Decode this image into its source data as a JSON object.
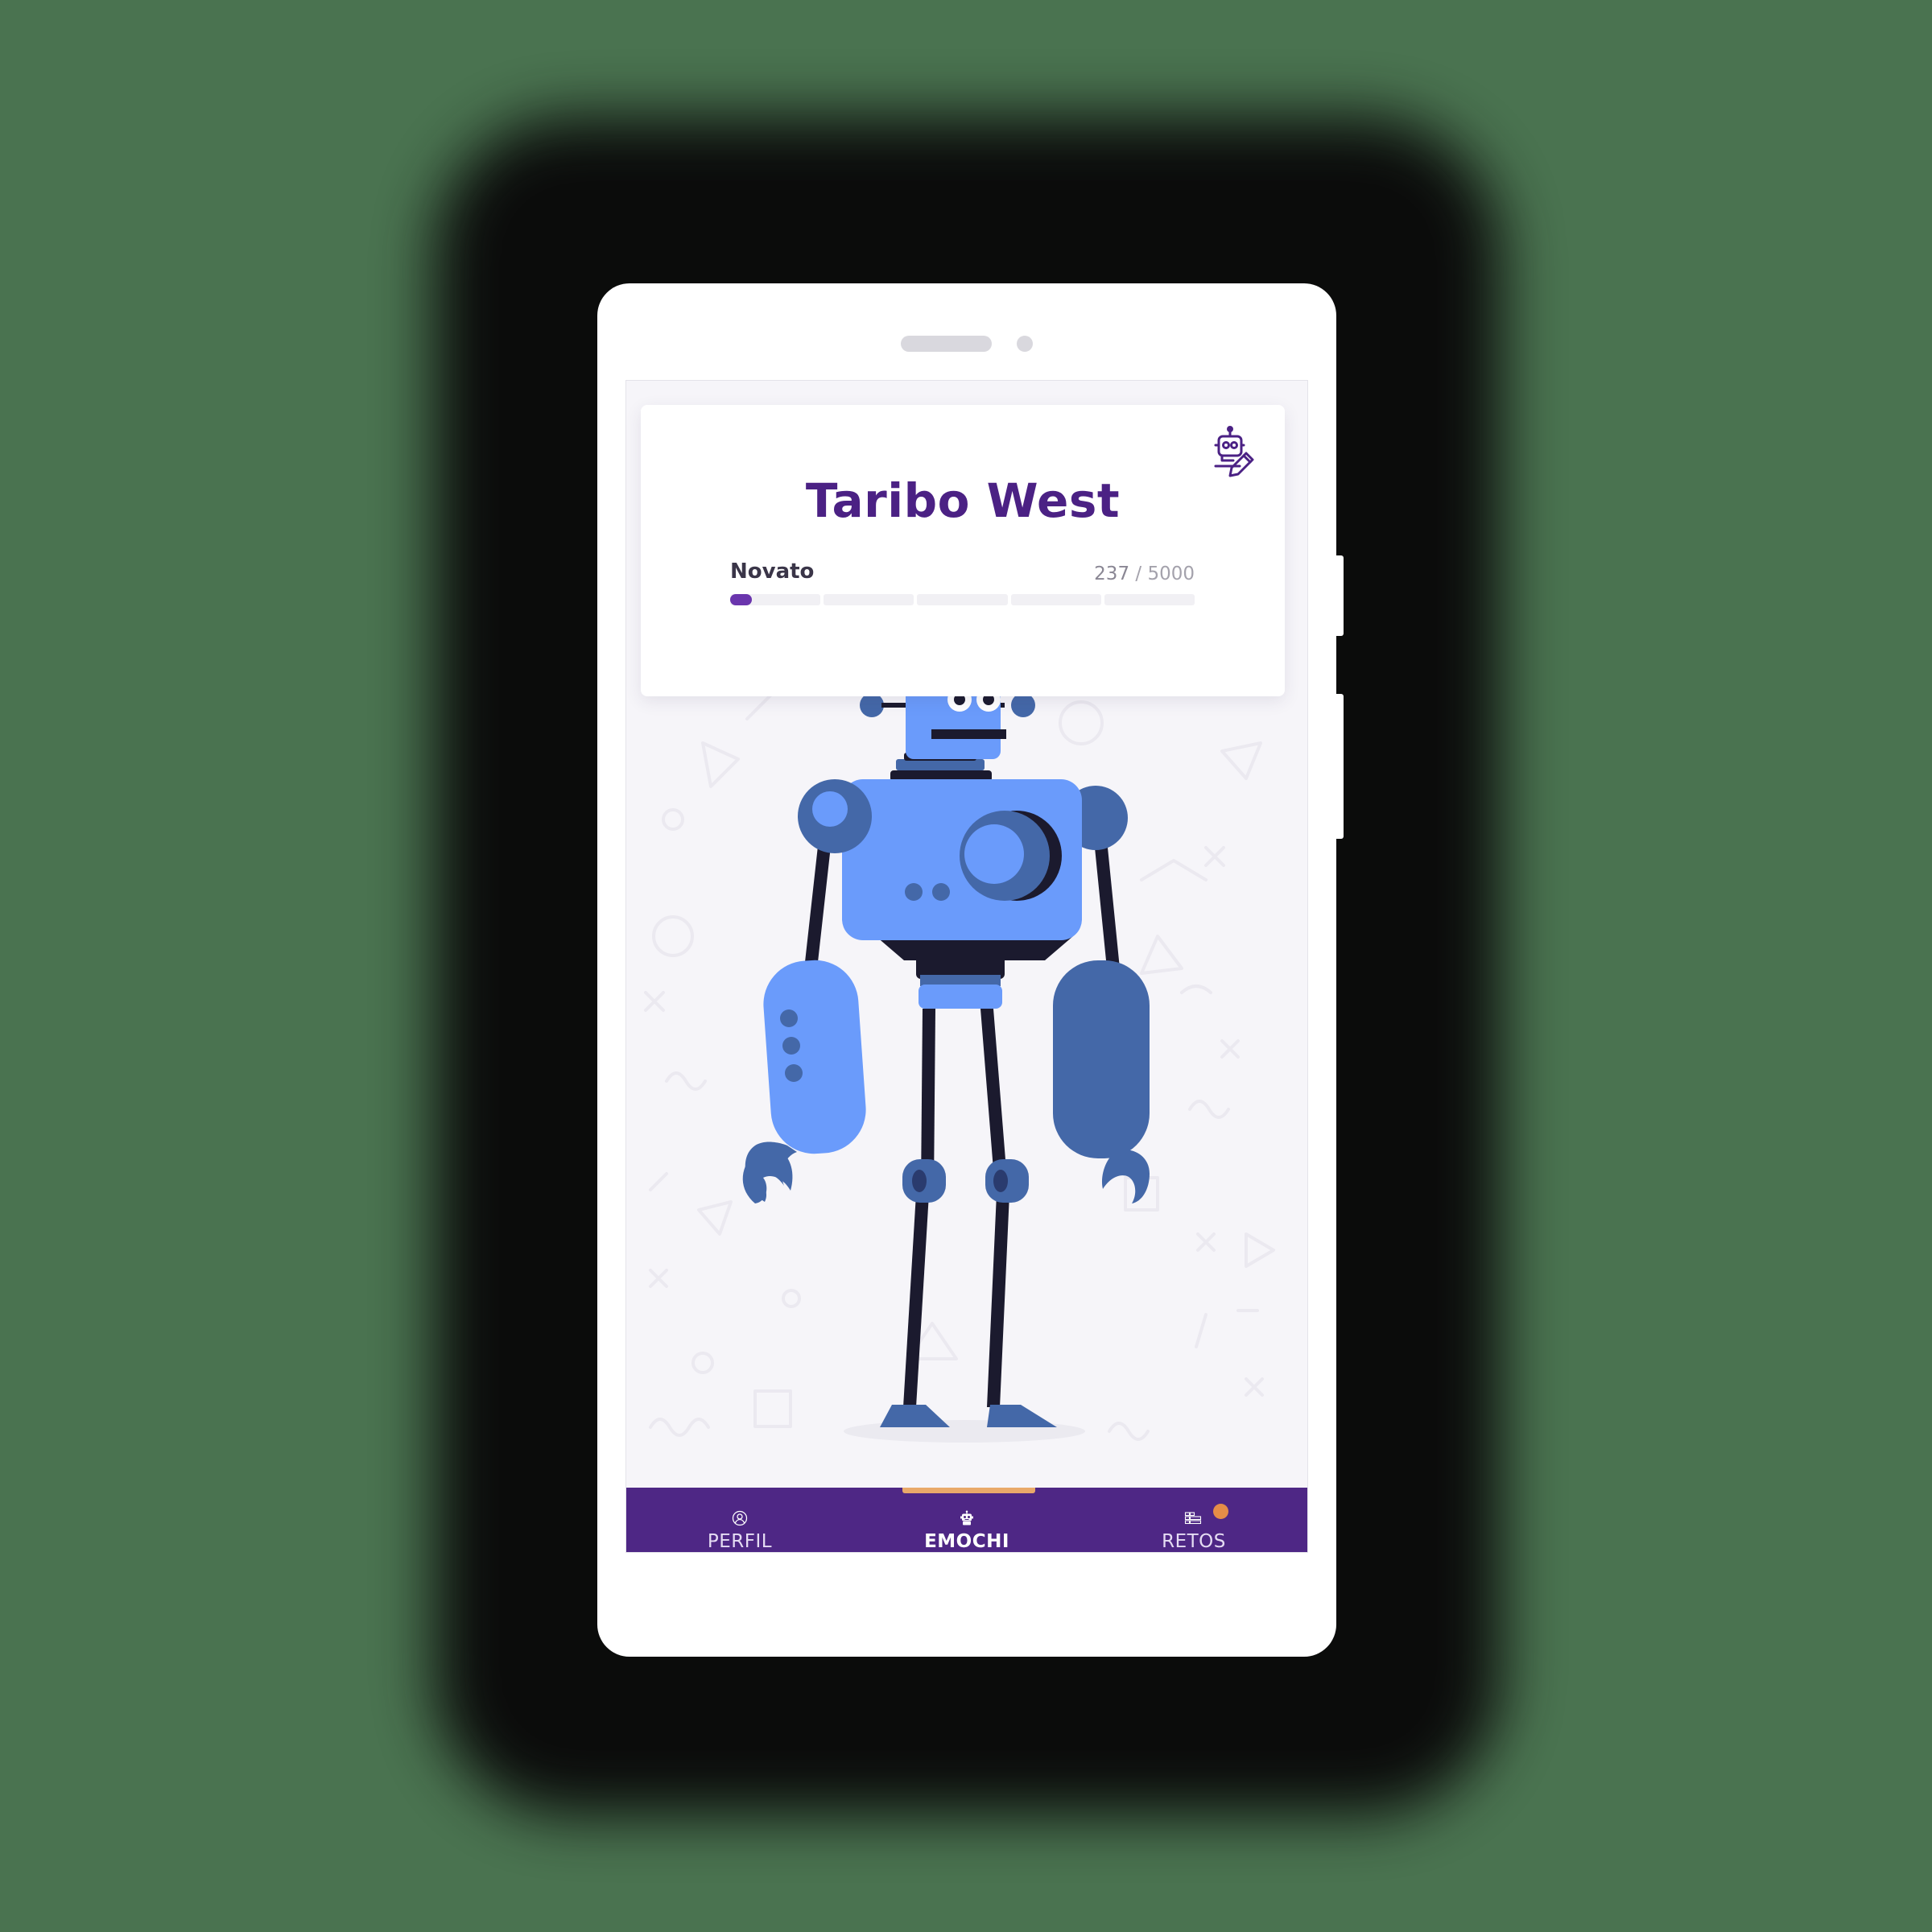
{
  "card": {
    "title": "Taribo West",
    "level": "Novato",
    "score_current": "237",
    "score_separator": "/",
    "score_max": "5000",
    "progress_fraction": 0.0474,
    "edit_icon": "robot-edit-icon"
  },
  "nav": {
    "active": "emochi",
    "items": [
      {
        "id": "perfil",
        "label": "PERFIL",
        "icon": "user-circle-icon"
      },
      {
        "id": "emochi",
        "label": "EMOCHI",
        "icon": "robot-icon"
      },
      {
        "id": "retos",
        "label": "RETOS",
        "icon": "challenges-list-icon",
        "badge": true
      }
    ],
    "indicator_color": "#e9a96a",
    "badge_color": "#e58d47"
  },
  "colors": {
    "brand_purple": "#4e2785",
    "title_purple": "#4b2184",
    "progress_fill": "#6a35ad",
    "robot_light_blue": "#6a9bfb",
    "robot_dark_blue": "#4468a8",
    "robot_legs": "#1b1a2e"
  }
}
